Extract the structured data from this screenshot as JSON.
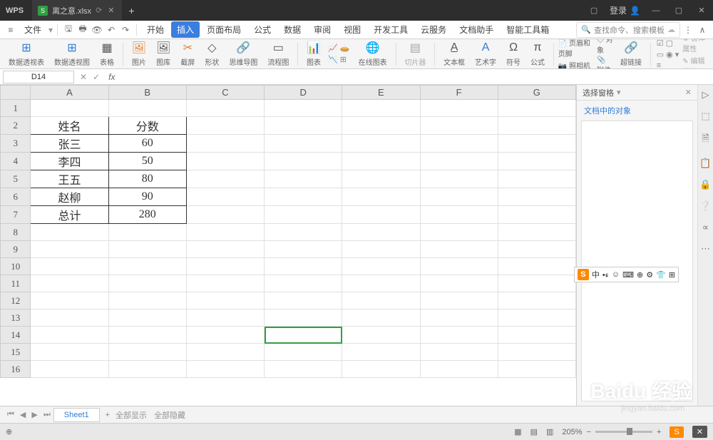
{
  "app": {
    "name": "WPS",
    "file": "离之意.xlsx",
    "login": "登录"
  },
  "menu": {
    "file": "文件",
    "items": [
      "开始",
      "插入",
      "页面布局",
      "公式",
      "数据",
      "审阅",
      "视图",
      "开发工具",
      "云服务",
      "文档助手",
      "智能工具箱"
    ],
    "active": 1,
    "search_placeholder": "查找命令、搜索模板"
  },
  "ribbon": {
    "g1": "数据透视表",
    "g2": "数据透视图",
    "g3": "表格",
    "g4": "图片",
    "g5": "图库",
    "g6": "截屏",
    "g7": "形状",
    "g8": "思维导图",
    "g8b": "流程图",
    "g9": "图表",
    "g10": "在线图表",
    "g11": "切片器",
    "g12": "文本框",
    "g13": "艺术字",
    "g14": "符号",
    "g15": "公式",
    "g16a": "页眉和页脚",
    "g16b": "照相机",
    "g17a": "对象",
    "g17b": "附件",
    "g18": "超链接",
    "g19a": "窗体属性",
    "g19b": "编辑代码"
  },
  "fbar": {
    "cell": "D14",
    "fx": "fx"
  },
  "sheet": {
    "columns": [
      "A",
      "B",
      "C",
      "D",
      "E",
      "F",
      "G"
    ],
    "rows": 16,
    "data": {
      "A2": "姓名",
      "B2": "分数",
      "A3": "张三",
      "B3": "60",
      "A4": "李四",
      "B4": "50",
      "A5": "王五",
      "B5": "80",
      "A6": "赵柳",
      "B6": "90",
      "A7": "总计",
      "B7": "280"
    },
    "bordered": [
      "A2",
      "B2",
      "A3",
      "B3",
      "A4",
      "B4",
      "A5",
      "B5",
      "A6",
      "B6",
      "A7",
      "B7"
    ],
    "selected": "D14",
    "tab": "Sheet1"
  },
  "rpanel": {
    "title": "选择窗格",
    "sub": "文档中的对象"
  },
  "ime": {
    "lang": "中",
    "icons": [
      "☺",
      "⌨",
      "⊕",
      "⚙",
      "👕",
      "⊞"
    ]
  },
  "status": {
    "l1": "全部显示",
    "l2": "全部隐藏",
    "zoom": "205%"
  },
  "watermark": {
    "brand": "Baidu 经验",
    "url": "jingyan.baidu.com"
  }
}
